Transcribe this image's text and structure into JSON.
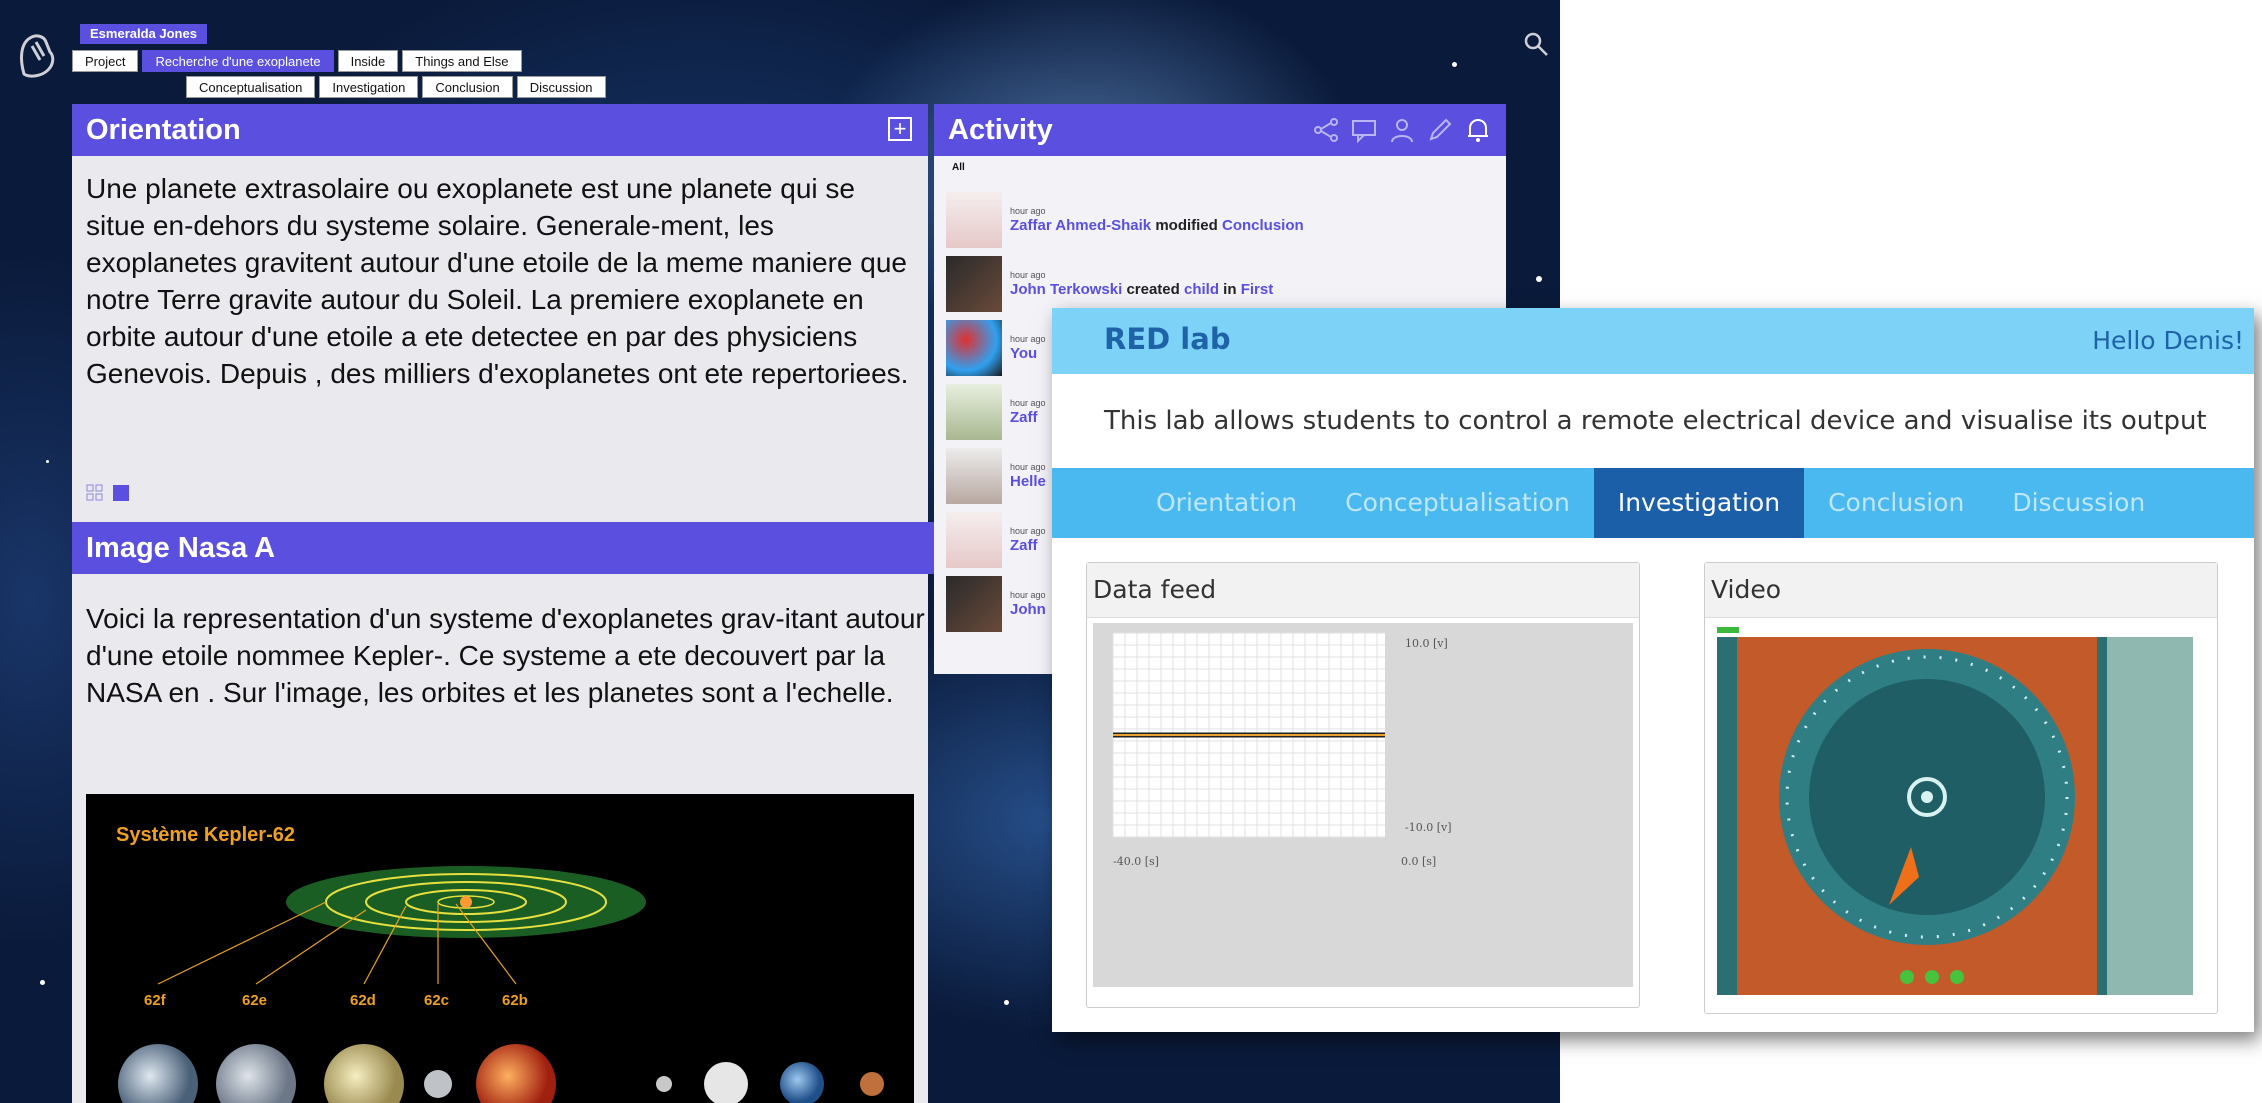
{
  "topnav": {
    "user": "Esmeralda Jones",
    "tabs": [
      "Project",
      "Recherche d'une exoplanete",
      "Inside",
      "Things and Else"
    ],
    "subtabs": [
      "Conceptualisation",
      "Investigation",
      "Conclusion",
      "Discussion"
    ]
  },
  "orientation": {
    "title": "Orientation",
    "text": "Une planete extrasolaire ou exoplanete est une planete qui se situe en-dehors du systeme solaire. Generale-ment, les exoplanetes gravitent autour d'une etoile de la meme maniere que notre Terre gravite autour du Soleil. La premiere exoplanete en orbite autour d'une etoile a ete detectee en  par des physiciens Genevois. Depuis , des milliers d'exoplanetes ont ete repertoriees."
  },
  "image_section": {
    "title": "Image Nasa A",
    "text": "Voici la representation d'un systeme d'exoplanetes grav-itant autour d'une etoile nommee Kepler-. Ce systeme a ete decouvert par la NASA en . Sur l'image, les orbites et les planetes sont a l'echelle.",
    "figure_title": "Système Kepler-62",
    "planet_labels": [
      "62f",
      "62e",
      "62d",
      "62c",
      "62b"
    ]
  },
  "activity": {
    "title": "Activity",
    "filter": "All",
    "items": [
      {
        "time": "hour ago",
        "user": "Zaffar Ahmed-Shaik",
        "action": "modified",
        "target": "Conclusion",
        "extra": "",
        "extra_target": ""
      },
      {
        "time": "hour ago",
        "user": "John Terkowski",
        "action": "created",
        "target": "child",
        "extra": "in",
        "extra_target": "First"
      },
      {
        "time": "hour ago",
        "user": "You",
        "action": "",
        "target": "",
        "extra": "",
        "extra_target": ""
      },
      {
        "time": "hour ago",
        "user": "Zaff",
        "action": "",
        "target": "",
        "extra": "",
        "extra_target": ""
      },
      {
        "time": "hour ago",
        "user": "Helle",
        "action": "",
        "target": "",
        "extra": "",
        "extra_target": ""
      },
      {
        "time": "hour ago",
        "user": "Zaff",
        "action": "",
        "target": "",
        "extra": "",
        "extra_target": ""
      },
      {
        "time": "hour ago",
        "user": "John",
        "action": "",
        "target": "",
        "extra": "",
        "extra_target": ""
      }
    ]
  },
  "redlab": {
    "title": "RED lab",
    "greeting": "Hello Denis!",
    "description": "This lab allows students to control a remote electrical device and visualise its output",
    "tabs": [
      "Orientation",
      "Conceptualisation",
      "Investigation",
      "Conclusion",
      "Discussion"
    ],
    "active_tab": "Investigation",
    "data_feed_title": "Data feed",
    "video_title": "Video"
  },
  "chart_data": {
    "type": "line",
    "series": [
      {
        "values": [
          [
            -40.0,
            0.0
          ],
          [
            0.0,
            0.0
          ]
        ],
        "color": "#e8a030"
      }
    ],
    "tick_labels": {
      "y_top": "10.0 [v]",
      "y_bottom": "-10.0 [v]",
      "x_left": "-40.0 [s]",
      "x_right": "0.0 [s]"
    },
    "xlim": [
      -40.0,
      0.0
    ],
    "ylim": [
      -10.0,
      10.0
    ],
    "grid": true
  },
  "colors": {
    "accent": "#5b4fe0",
    "redlab_header": "#7dd3f7",
    "redlab_nav": "#4ab9ef",
    "redlab_active": "#1b5fa8"
  }
}
